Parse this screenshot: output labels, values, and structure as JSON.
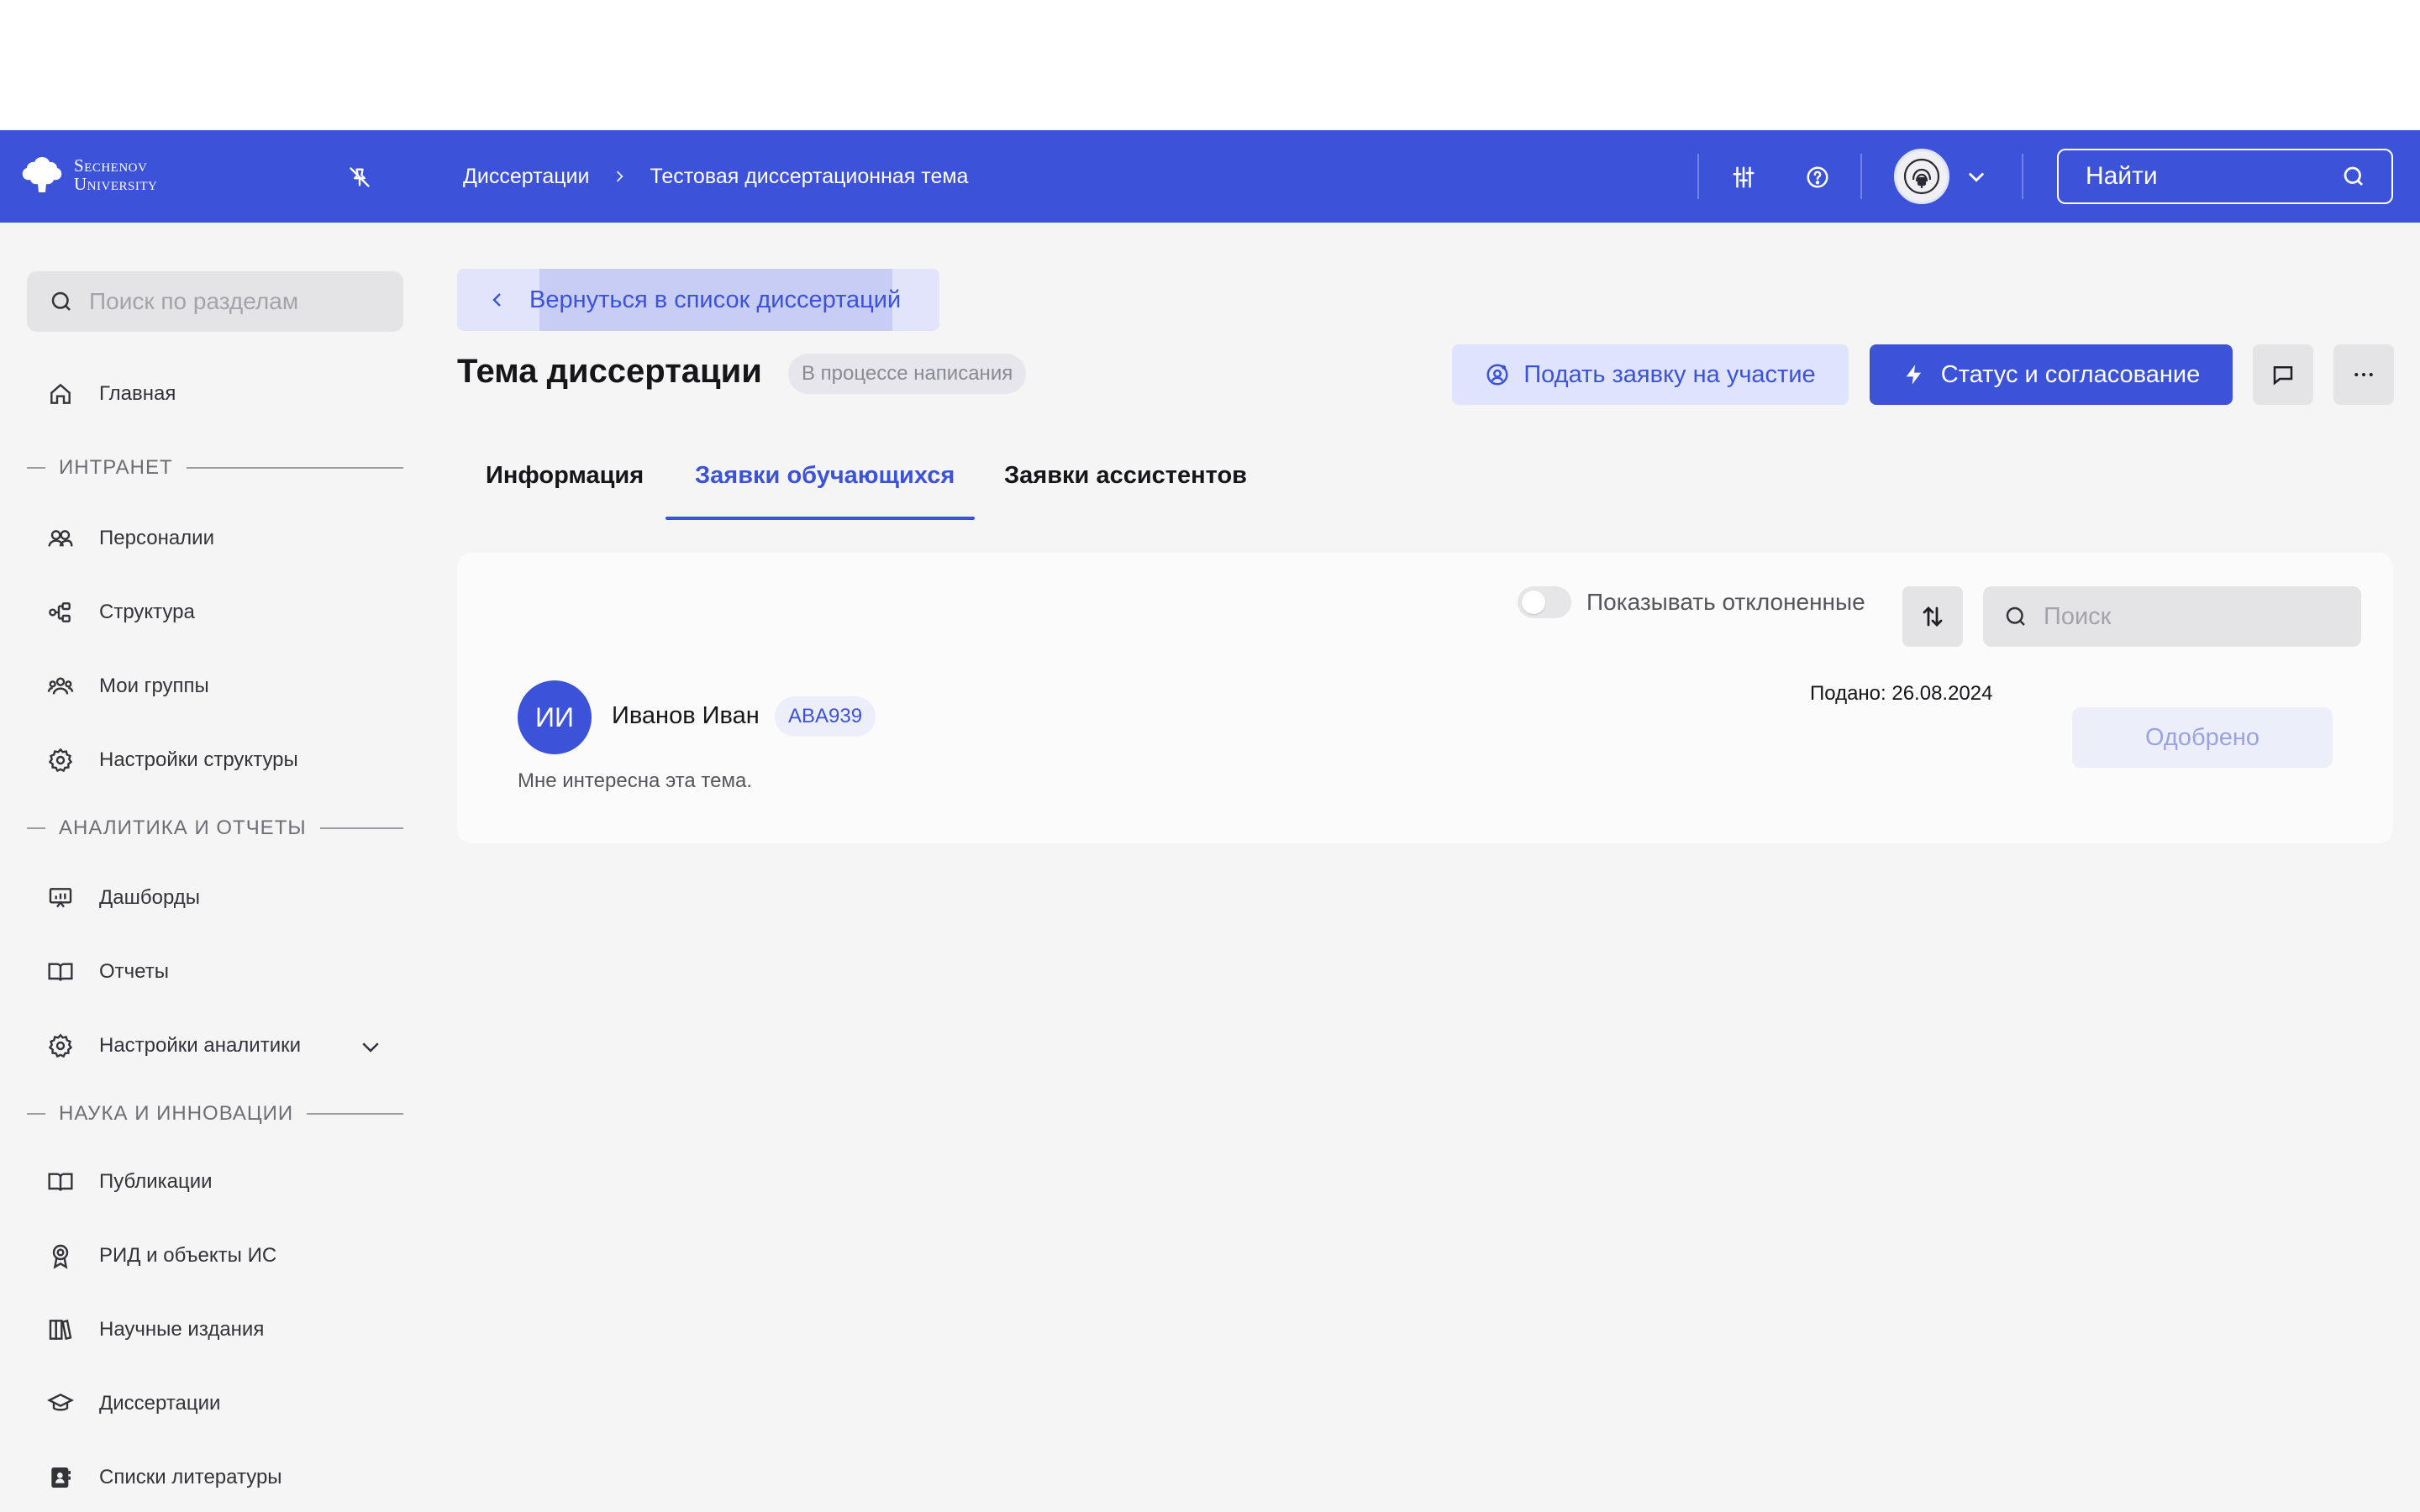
{
  "header": {
    "logo_line1": "Sechenov",
    "logo_line2": "University",
    "breadcrumb": [
      "Диссертации",
      "Тестовая диссертационная тема"
    ],
    "search_label": "Найти",
    "icons": [
      "pin-off-icon",
      "sliders-icon",
      "help-circle-icon",
      "chevron-down-icon",
      "search-icon"
    ]
  },
  "sidebar": {
    "search_placeholder": "Поиск по разделам",
    "home": "Главная",
    "section_intranet": "ИНТРАНЕТ",
    "intranet_items": [
      "Персоналии",
      "Структура",
      "Мои группы",
      "Настройки структуры"
    ],
    "section_analytics": "АНАЛИТИКА И ОТЧЕТЫ",
    "analytics_items": [
      "Дашборды",
      "Отчеты",
      "Настройки аналитики"
    ],
    "section_science": "НАУКА И ИННОВАЦИИ",
    "science_items": [
      "Публикации",
      "РИД и объекты ИС",
      "Научные издания",
      "Диссертации",
      "Списки литературы"
    ]
  },
  "main": {
    "back_label": "Вернуться в список диссертаций",
    "title": "Тема диссертации",
    "status": "В процессе написания",
    "apply_label": "Подать заявку на участие",
    "status_button_label": "Статус и согласование",
    "tabs": [
      "Информация",
      "Заявки обучающихся",
      "Заявки ассистентов"
    ],
    "active_tab": 1
  },
  "applications": {
    "show_rejected_label": "Показывать отклоненные",
    "show_rejected": false,
    "search_placeholder": "Поиск",
    "items": [
      {
        "initials": "ИИ",
        "name": "Иванов Иван",
        "code": "ABA939",
        "message": "Мне интересна эта тема.",
        "date_label": "Подано: 26.08.2024",
        "status": "Одобрено"
      }
    ]
  },
  "colors": {
    "primary": "#3b52d9",
    "primary_light": "#dfe3fb",
    "background": "#f5f5f6"
  }
}
